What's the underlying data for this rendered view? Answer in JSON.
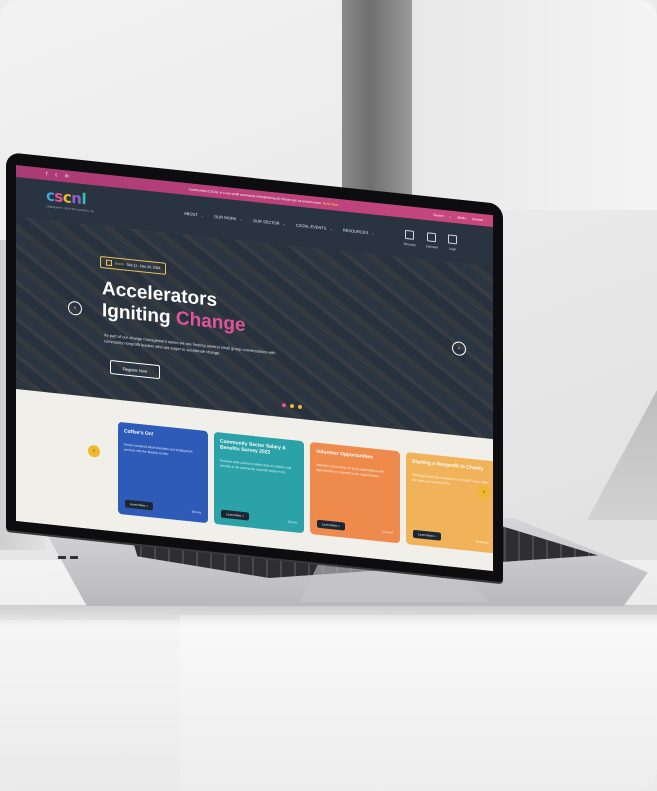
{
  "topbar": {
    "social": [
      "f",
      "t",
      "in"
    ],
    "announcement": "Communities CSCNL is a non-profit community strengthening all. Please join us to learn more.",
    "announcement_link": "Read More",
    "tools": [
      "Search",
      "Media",
      "Contact"
    ]
  },
  "header": {
    "logo": [
      "c",
      "s",
      "c",
      "n",
      "l"
    ],
    "logo_colors": [
      "#3aa7e0",
      "#e0549a",
      "#f0b92c",
      "#8b5fd0",
      "#2fc4b2"
    ],
    "logo_subtitle": "COMMUNITY SECTOR COUNCIL NL",
    "nav": [
      "ABOUT",
      "OUR WORK",
      "OUR SECTOR",
      "CSCNL EVENTS",
      "RESOURCES"
    ],
    "quick_links": [
      "Directory",
      "Calendar",
      "Login"
    ]
  },
  "hero": {
    "event_label": "Event",
    "event_dates": "Dec 11 - Dec 20, 2022",
    "title_line1": "Accelerators",
    "title_line2_prefix": "Igniting ",
    "title_line2_highlight": "Change",
    "description": "As part of our change management series we are hosting several small group conversations with community nonprofit leaders who are eager to accelerate change.",
    "button": "Register Now",
    "dot_colors": [
      "#e0549a",
      "#f0b92c",
      "#f0b92c"
    ]
  },
  "cards": [
    {
      "title": "Coffee's On!",
      "desc": "Person-centered adult education and employment services with the Murphy Centre.",
      "button": "Learn More »",
      "tag": "Survey",
      "color": "#2e5bb8"
    },
    {
      "title": "Community Sector Salary & Benefits Survey 2022",
      "desc": "Province-wide survey to collect data on salaries and benefits in the community nonprofit sector in NL.",
      "button": "Learn More »",
      "tag": "Survey",
      "color": "#2aa2a8"
    },
    {
      "title": "Volunteer Opportunities",
      "desc": "Volunteer connectivity via local organizations and opportunities to nonprofit sector organizations.",
      "button": "Learn More »",
      "tag": "General",
      "color": "#ee8a4c"
    },
    {
      "title": "Starting a Nonprofit in Charity",
      "desc": "Thinking of starting a nonprofit or a charity? Learn about the steps and requirements.",
      "button": "Learn More »",
      "tag": "Resource",
      "color": "#f0b35a"
    }
  ]
}
